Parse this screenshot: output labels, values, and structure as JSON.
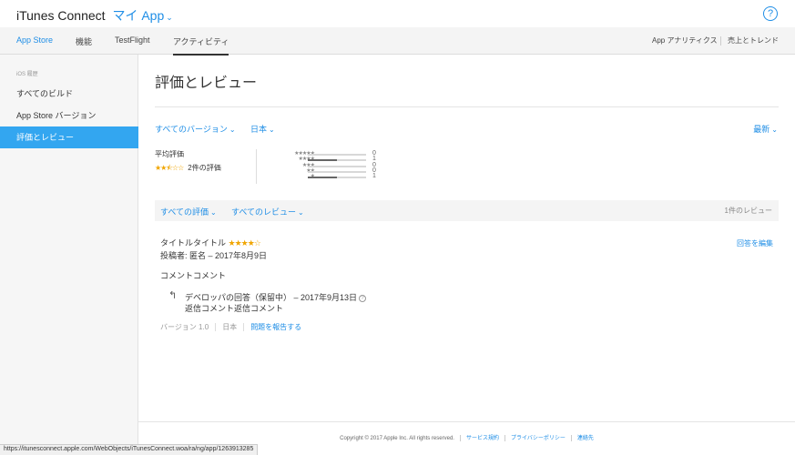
{
  "header": {
    "brand": "iTunes Connect",
    "app_menu": "マイ App",
    "help_icon": "question-circle-icon",
    "help_label": "?"
  },
  "nav": {
    "tabs": [
      {
        "label": "App Store"
      },
      {
        "label": "機能"
      },
      {
        "label": "TestFlight"
      },
      {
        "label": "アクティビティ"
      }
    ],
    "right_links": [
      {
        "label": "App アナリティクス"
      },
      {
        "label": "売上とトレンド"
      }
    ]
  },
  "sidebar": {
    "heading": "iOS 履歴",
    "items": [
      {
        "label": "すべてのビルド"
      },
      {
        "label": "App Store バージョン"
      },
      {
        "label": "評価とレビュー"
      }
    ]
  },
  "main": {
    "title": "評価とレビュー",
    "filters": {
      "version": "すべてのバージョン",
      "country": "日本",
      "sort": "最新"
    },
    "summary": {
      "avg_label": "平均評価",
      "avg_stars": "★★⯪☆☆",
      "avg_rating": 2.5,
      "count_text": "2件の評価"
    },
    "histogram": [
      {
        "stars": "★★★★★",
        "count": "0",
        "fraction": 0
      },
      {
        "stars": "★★★★",
        "count": "1",
        "fraction": 0.5
      },
      {
        "stars": "★★★",
        "count": "0",
        "fraction": 0
      },
      {
        "stars": "★★",
        "count": "0",
        "fraction": 0
      },
      {
        "stars": "★",
        "count": "1",
        "fraction": 0.5
      }
    ],
    "review_filters": {
      "rating": "すべての評価",
      "review": "すべてのレビュー",
      "count": "1件のレビュー"
    },
    "review": {
      "title": "タイトルタイトル",
      "stars": "★★★★☆",
      "author": "投稿者: 匿名 – 2017年8月9日",
      "edit_label": "回答を編集",
      "body": "コメントコメント",
      "reply_icon": "reply-arrow-icon",
      "reply_glyph": "↰",
      "reply_header": "デベロッパの回答（保留中） – 2017年9月13日",
      "reply_help": "?",
      "reply_body": "返信コメント返信コメント",
      "version": "バージョン 1.0",
      "country": "日本",
      "report_label": "問題を報告する"
    }
  },
  "footer": {
    "copyright": "Copyright © 2017 Apple Inc. All rights reserved.",
    "links": [
      "サービス規約",
      "プライバシーポリシー",
      "連絡先"
    ]
  },
  "status_url": "https://itunesconnect.apple.com/WebObjects/iTunesConnect.woa/ra/ng/app/1263913285",
  "colors": {
    "accent": "#1f8ee6",
    "selected": "#33a6f0",
    "star": "#f0a500"
  }
}
